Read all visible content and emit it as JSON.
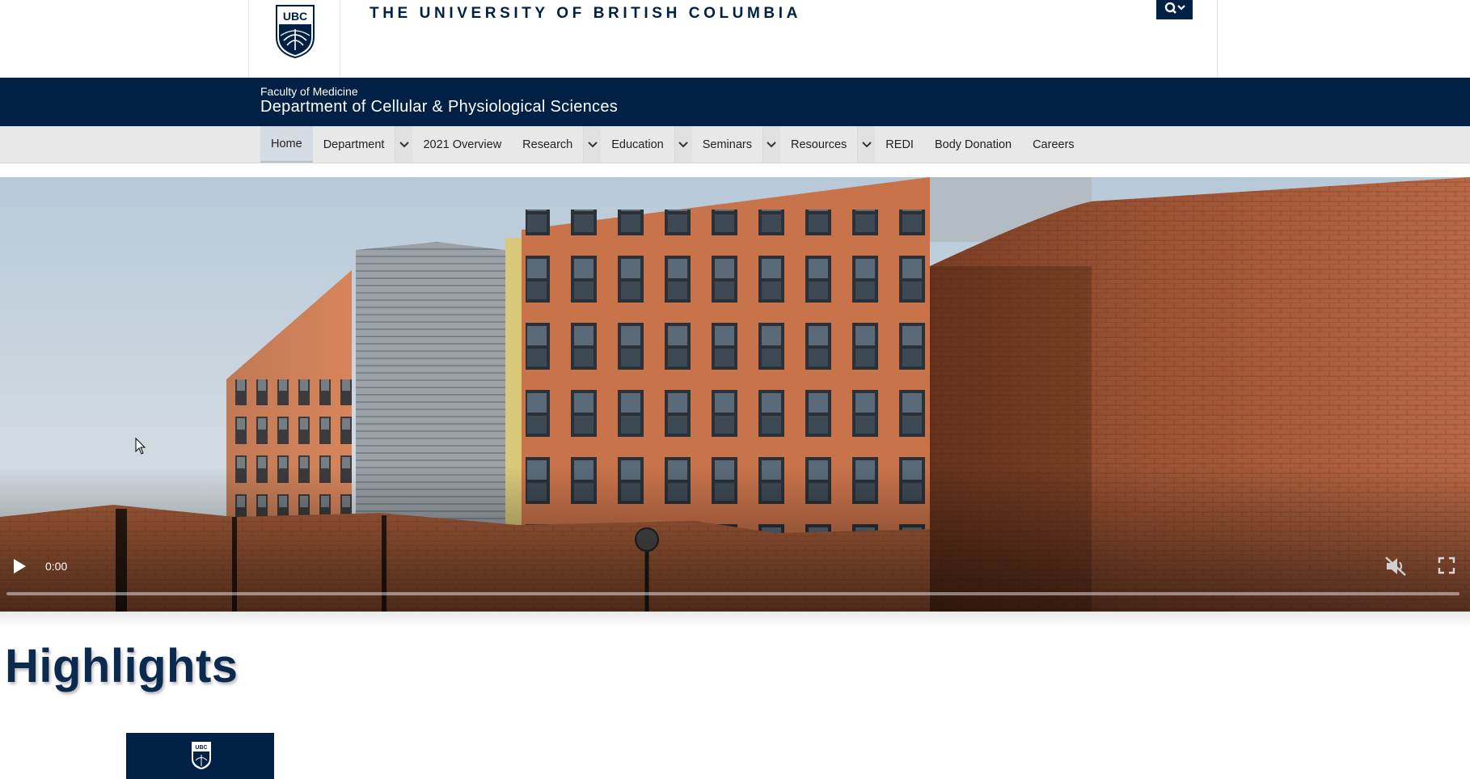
{
  "header": {
    "logo_text": "UBC",
    "wordmark": "THE UNIVERSITY OF BRITISH COLUMBIA",
    "search_icon": "search-icon"
  },
  "unit": {
    "faculty": "Faculty of Medicine",
    "department": "Department of Cellular & Physiological Sciences"
  },
  "nav": {
    "items": [
      {
        "label": "Home",
        "active": true,
        "has_dropdown": false
      },
      {
        "label": "Department",
        "active": false,
        "has_dropdown": true
      },
      {
        "label": "2021 Overview",
        "active": false,
        "has_dropdown": false
      },
      {
        "label": "Research",
        "active": false,
        "has_dropdown": true
      },
      {
        "label": "Education",
        "active": false,
        "has_dropdown": true
      },
      {
        "label": "Seminars",
        "active": false,
        "has_dropdown": true
      },
      {
        "label": "Resources",
        "active": false,
        "has_dropdown": true
      },
      {
        "label": "REDI",
        "active": false,
        "has_dropdown": false
      },
      {
        "label": "Body Donation",
        "active": false,
        "has_dropdown": false
      },
      {
        "label": "Careers",
        "active": false,
        "has_dropdown": false
      }
    ]
  },
  "video": {
    "time": "0:00",
    "progress": 0,
    "muted": true,
    "icons": [
      "play-icon",
      "muted-speaker-icon",
      "fullscreen-icon"
    ]
  },
  "highlights": {
    "title": "Highlights",
    "card_logo_text": "UBC"
  },
  "colors": {
    "ubc_navy": "#002145",
    "nav_bg": "#e8e8e8",
    "heading": "#0b2a4e"
  }
}
